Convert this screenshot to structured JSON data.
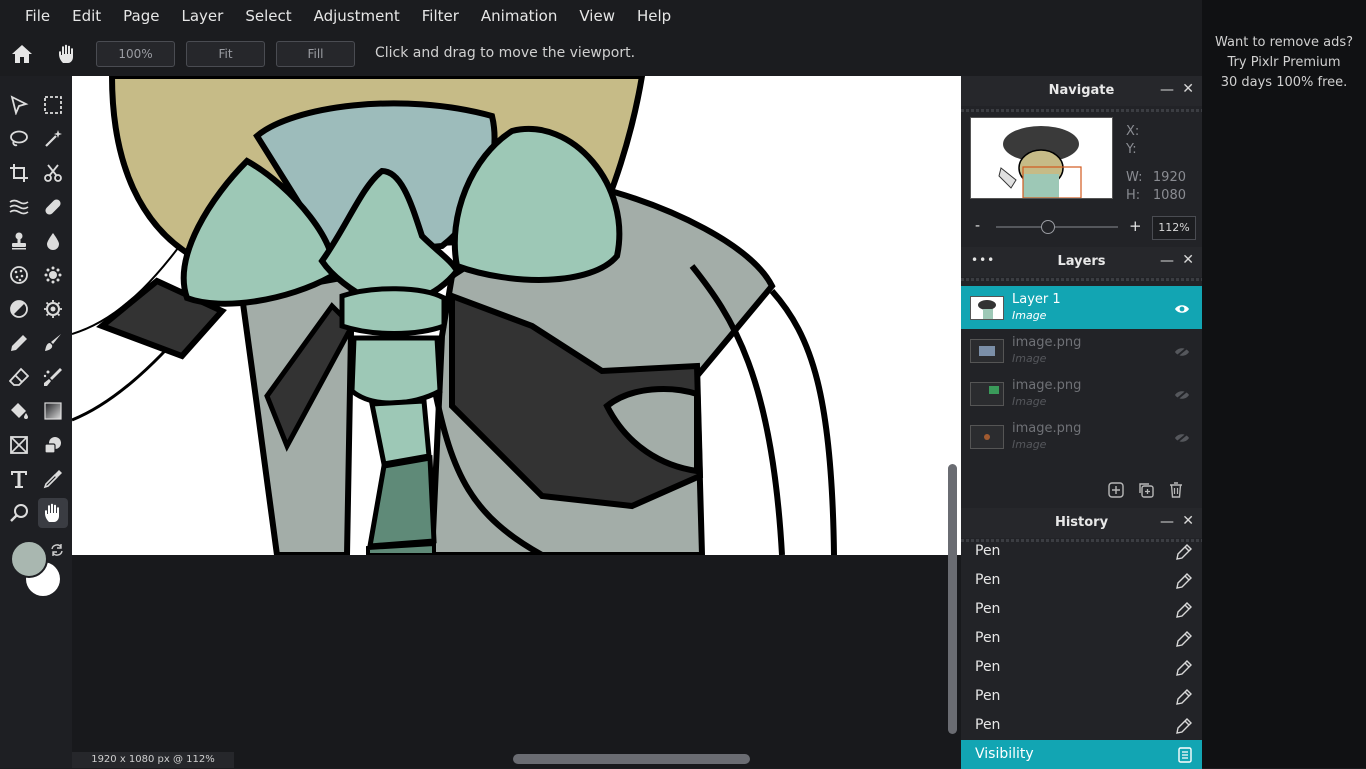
{
  "menu": [
    "File",
    "Edit",
    "Page",
    "Layer",
    "Select",
    "Adjustment",
    "Filter",
    "Animation",
    "View",
    "Help"
  ],
  "toolbar": {
    "zoom_button": "100%",
    "fit_button": "Fit",
    "fill_button": "Fill",
    "hint": "Click and drag to move the viewport."
  },
  "tools": [
    "arrange-icon",
    "marquee-icon",
    "lasso-icon",
    "magic-wand-icon",
    "crop-icon",
    "cutout-icon",
    "liquify-icon",
    "heal-icon",
    "clone-stamp-icon",
    "blur-icon",
    "sponge-icon",
    "dodge-icon",
    "color-replace-icon",
    "sharpen-icon",
    "pen-icon",
    "brush-icon",
    "eraser-icon",
    "smudge-icon",
    "paint-bucket-icon",
    "gradient-icon",
    "frame-icon",
    "shape-icon",
    "text-icon",
    "color-picker-icon",
    "zoom-icon",
    "hand-icon"
  ],
  "colors": {
    "foreground": "#a9b7b0",
    "background": "#ffffff",
    "accent": "#12a5b3"
  },
  "navigate": {
    "title": "Navigate",
    "x_label": "X:",
    "x_value": "",
    "y_label": "Y:",
    "y_value": "",
    "w_label": "W:",
    "w_value": "1920",
    "h_label": "H:",
    "h_value": "1080",
    "zoom_minus": "-",
    "zoom_plus": "+",
    "zoom_value": "112%",
    "zoom_level": 0.42
  },
  "layers": {
    "title": "Layers",
    "menu_glyph": "•••",
    "items": [
      {
        "name": "Layer 1",
        "type": "Image",
        "visible": true,
        "selected": true
      },
      {
        "name": "image.png",
        "type": "Image",
        "visible": false,
        "selected": false
      },
      {
        "name": "image.png",
        "type": "Image",
        "visible": false,
        "selected": false
      },
      {
        "name": "image.png",
        "type": "Image",
        "visible": false,
        "selected": false
      }
    ]
  },
  "history": {
    "title": "History",
    "items": [
      {
        "name": "Pen",
        "icon": "pen-icon"
      },
      {
        "name": "Pen",
        "icon": "pen-icon"
      },
      {
        "name": "Pen",
        "icon": "pen-icon"
      },
      {
        "name": "Pen",
        "icon": "pen-icon"
      },
      {
        "name": "Pen",
        "icon": "pen-icon"
      },
      {
        "name": "Pen",
        "icon": "pen-icon"
      },
      {
        "name": "Pen",
        "icon": "pen-icon"
      },
      {
        "name": "Visibility",
        "icon": "visibility-doc-icon",
        "current": true
      }
    ]
  },
  "status": "1920 x 1080 px @ 112%",
  "ad": {
    "line1": "Want to remove ads?",
    "line2": "Try Pixlr Premium",
    "line3": "30 days 100% free."
  }
}
